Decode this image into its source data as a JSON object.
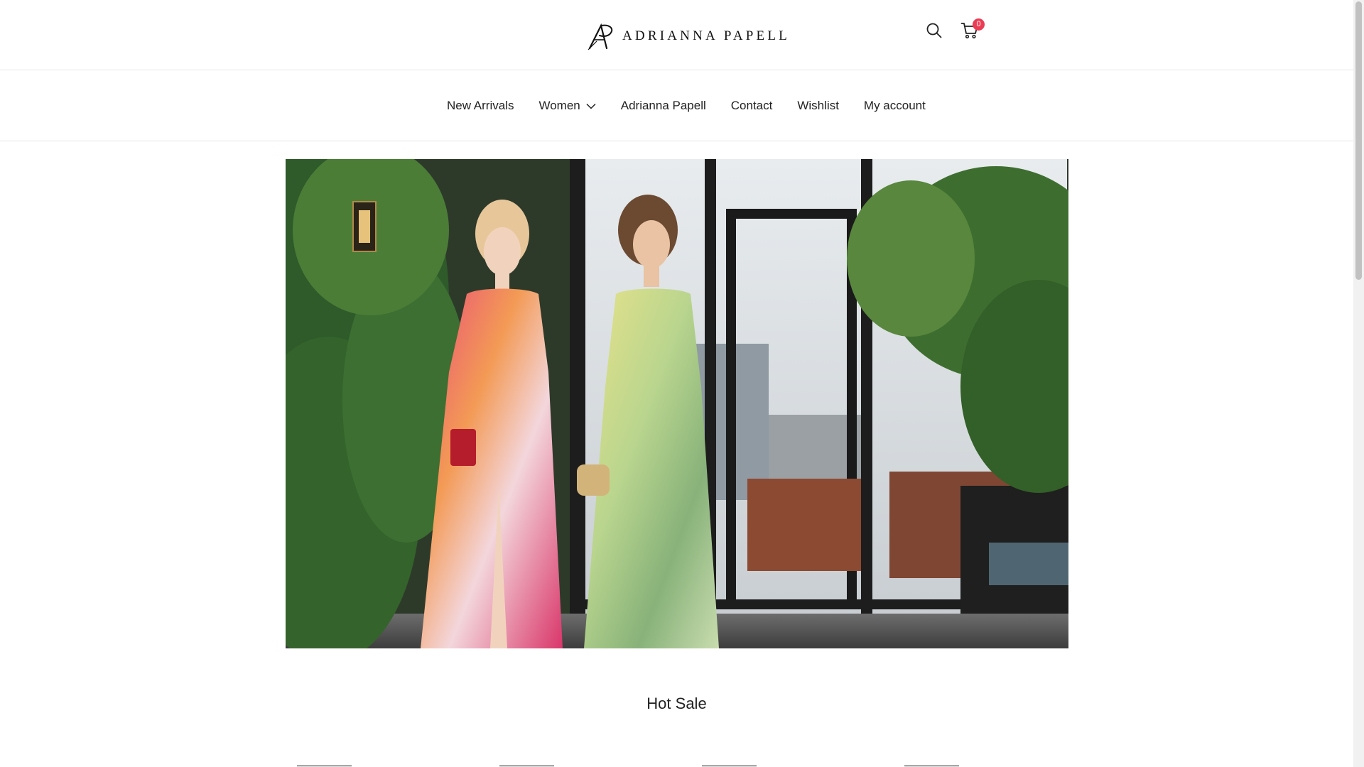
{
  "header": {
    "logo_text": "ADRIANNA PAPELL",
    "cart_count": "0",
    "icons": [
      "search-icon",
      "cart-icon"
    ]
  },
  "nav": {
    "items": [
      {
        "label": "New Arrivals"
      },
      {
        "label": "Women",
        "has_dropdown": true
      },
      {
        "label": "Adrianna Papell"
      },
      {
        "label": "Contact"
      },
      {
        "label": "Wishlist"
      },
      {
        "label": "My account"
      }
    ]
  },
  "hero": {
    "image": "hero-banner-image"
  },
  "hot_sale": {
    "title": "Hot Sale"
  },
  "colors": {
    "badge": "#ea3d55",
    "text": "#222222",
    "border": "#e6e6e6"
  }
}
